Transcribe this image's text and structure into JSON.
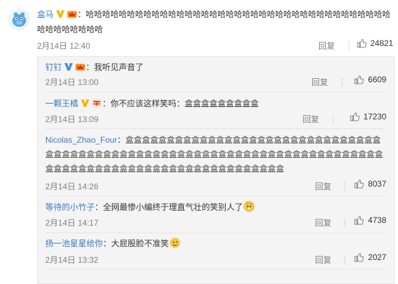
{
  "main": {
    "username": "盒马",
    "content": "：哈哈哈哈哈哈哈哈哈哈哈哈哈哈哈哈哈哈哈哈哈哈哈哈哈哈哈哈哈哈哈哈哈哈哈哈哈哈哈哈哈哈哈哈哈",
    "date": "2月14日 12:40",
    "reply_label": "回复",
    "likes": "24821"
  },
  "replies": [
    {
      "username": "钉钉",
      "content": "：我听见声音了",
      "date": "2月14日 13:00",
      "reply_label": "回复",
      "likes": "6609"
    },
    {
      "username": "一颗王橘",
      "content": "：你不应该这样笑吗：盒盒盒盒盒盒盒盒盒",
      "date": "2月14日 13:09",
      "reply_label": "回复",
      "likes": "17230"
    },
    {
      "username": "Nicolas_Zhao_Four",
      "content": "：盒盒盒盒盒盒盒盒盒盒盒盒盒盒盒盒盒盒盒盒盒盒盒盒盒盒盒盒盒盒盒盒盒盒盒盒盒盒盒盒盒盒盒盒盒盒盒盒盒盒盒盒盒盒盒盒盒盒盒盒盒盒盒盒盒盒盒盒盒盒盒盒盒盒盒盒盒盒盒盒盒盒盒盒盒盒盒盒盒盒盒盒盒盒盒盒盒盒盒盒盒",
      "date": "2月14日 14:26",
      "reply_label": "回复",
      "likes": "8037"
    },
    {
      "username": "等待的小竹子",
      "content": "：全网最惨小编终于理直气壮的笑别人了",
      "date": "2月14日 14:17",
      "reply_label": "回复",
      "likes": "4738"
    },
    {
      "username": "扬一池星星给你",
      "content": "：大屁股脸不准笑",
      "date": "2月14日 13:32",
      "reply_label": "回复",
      "likes": "2027"
    }
  ],
  "colors": {
    "username_link": "#3a7bbf",
    "verified_badge": "#f5b400",
    "meta_text": "#808080",
    "reply_panel_bg": "#f4f4f4"
  },
  "icons": {
    "avatar": "hema-hippo-avatar",
    "verified": "verified-v-icon",
    "member": "member-crown-icon",
    "like": "thumbs-up-icon"
  }
}
